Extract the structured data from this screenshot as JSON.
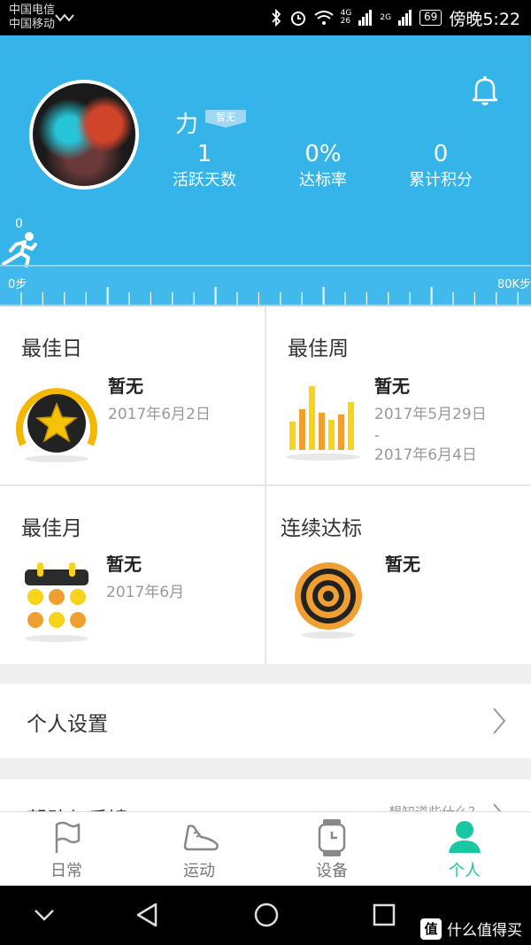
{
  "status_bar": {
    "carrier_1": "中国电信",
    "carrier_2": "中国移动",
    "battery": "69",
    "time": "傍晚5:22",
    "net_1": "4G",
    "net_2": "2G"
  },
  "profile": {
    "username": "力",
    "badge": "暂无",
    "stats": [
      {
        "value": "1",
        "label": "活跃天数"
      },
      {
        "value": "0%",
        "label": "达标率"
      },
      {
        "value": "0",
        "label": "累计积分"
      }
    ],
    "steps_value": "0",
    "ruler_start": "0步",
    "ruler_end": "80K步"
  },
  "cards": {
    "best_day": {
      "title": "最佳日",
      "main": "暂无",
      "date": "2017年6月2日"
    },
    "best_week": {
      "title": "最佳周",
      "main": "暂无",
      "date_start": "2017年5月29日",
      "sep": "-",
      "date_end": "2017年6月4日"
    },
    "best_month": {
      "title": "最佳月",
      "main": "暂无",
      "date": "2017年6月"
    },
    "streak": {
      "title": "连续达标",
      "main": "暂无"
    }
  },
  "menu": {
    "settings": "个人设置",
    "help": "帮助与反馈",
    "help_hint": "想知道些什么？"
  },
  "tabs": [
    {
      "label": "日常"
    },
    {
      "label": "运动"
    },
    {
      "label": "设备"
    },
    {
      "label": "个人"
    }
  ],
  "watermark": {
    "badge": "值",
    "text": "什么值得买"
  },
  "colors": {
    "header": "#35b4ea",
    "accent": "#19c7a5",
    "gold": "#f5b800",
    "orange": "#f0a030"
  }
}
